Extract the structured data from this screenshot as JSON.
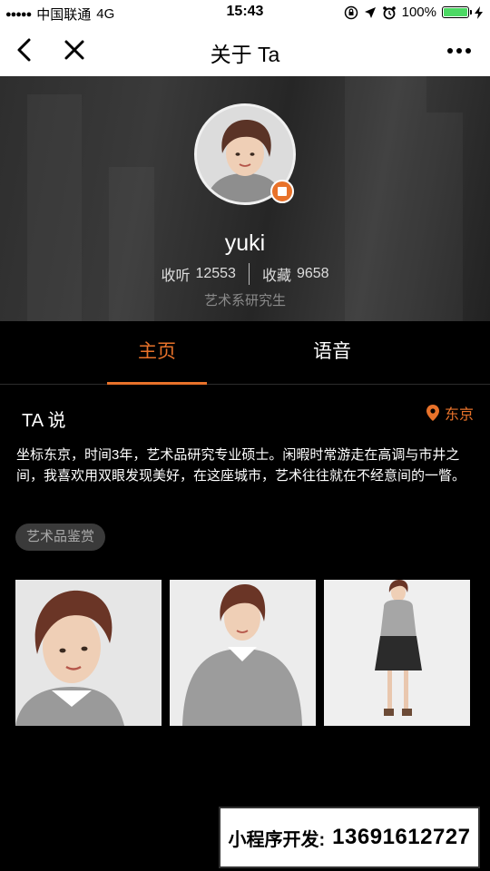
{
  "status_bar": {
    "signal": "●●●●●",
    "carrier": "中国联通",
    "network": "4G",
    "time": "15:43",
    "battery": "100%",
    "battery_level": 1.0
  },
  "nav": {
    "title": "关于 Ta"
  },
  "profile": {
    "username": "yuki",
    "listen_label": "收听",
    "listen_count": "12553",
    "favorite_label": "收藏",
    "favorite_count": "9658",
    "subtitle": "艺术系研究生"
  },
  "tabs": [
    {
      "label": "主页",
      "active": true
    },
    {
      "label": "语音",
      "active": false
    }
  ],
  "content": {
    "section_title": "TA 说",
    "location": "东京",
    "bio": "坐标东京，时间3年，艺术品研究专业硕士。闲暇时常游走在高调与市井之间，我喜欢用双眼发现美好，在这座城市，艺术往往就在不经意间的一瞥。",
    "tag": "艺术品鉴赏"
  },
  "watermark": {
    "label": "小程序开发:",
    "phone": "13691612727"
  },
  "colors": {
    "accent": "#e8722a",
    "background": "#000000"
  }
}
